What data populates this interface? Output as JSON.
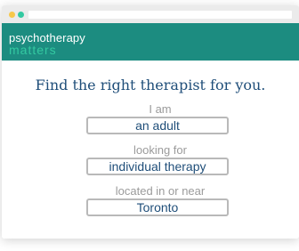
{
  "brand": {
    "name_top": "psychotherapy",
    "name_bottom": "matters"
  },
  "search": {
    "headline": "Find the right therapist for you.",
    "who_label": "I am",
    "who_value": "an adult",
    "what_label": "looking for",
    "what_value": "individual therapy",
    "where_label": "located in or near",
    "where_value": "Toronto"
  },
  "colors": {
    "brand_teal": "#1c8c80",
    "accent_green": "#33c9a1",
    "dot_yellow": "#f7c84a",
    "dot_green": "#33c9a1",
    "headline_text": "#1f4e79",
    "label_text": "#9b9b9b",
    "field_text": "#1f4e79"
  }
}
